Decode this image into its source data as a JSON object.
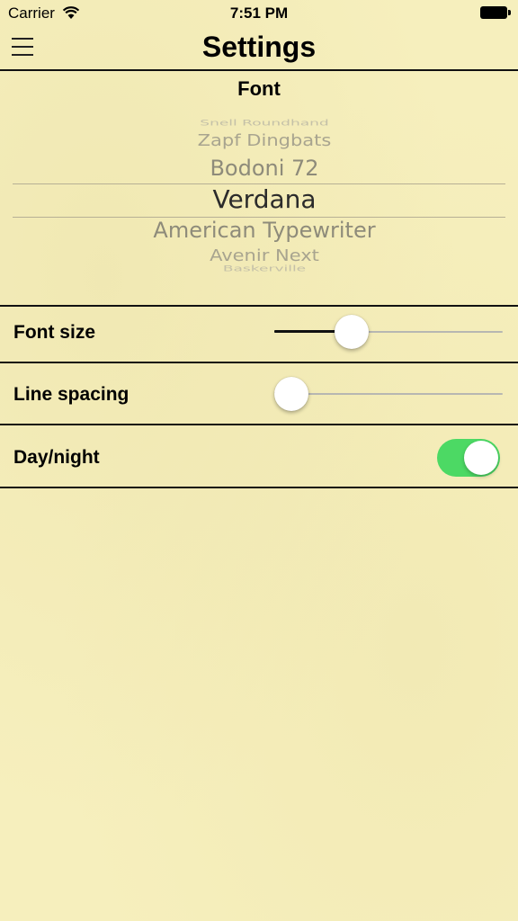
{
  "status_bar": {
    "carrier": "Carrier",
    "time": "7:51 PM"
  },
  "nav": {
    "title": "Settings"
  },
  "font_section": {
    "title": "Font",
    "picker_items": [
      "Snell Roundhand",
      "Zapf Dingbats",
      "Bodoni 72",
      "Verdana",
      "American Typewriter",
      "Avenir Next",
      "Baskerville"
    ],
    "selected": "Verdana"
  },
  "settings": {
    "font_size": {
      "label": "Font size",
      "value": 0.34
    },
    "line_spacing": {
      "label": "Line spacing",
      "value": 0.07
    },
    "day_night": {
      "label": "Day/night",
      "on": true
    }
  },
  "colors": {
    "background": "#f6efbd",
    "toggle_on": "#4cd964",
    "picker_dim": "#8e8b7a"
  }
}
